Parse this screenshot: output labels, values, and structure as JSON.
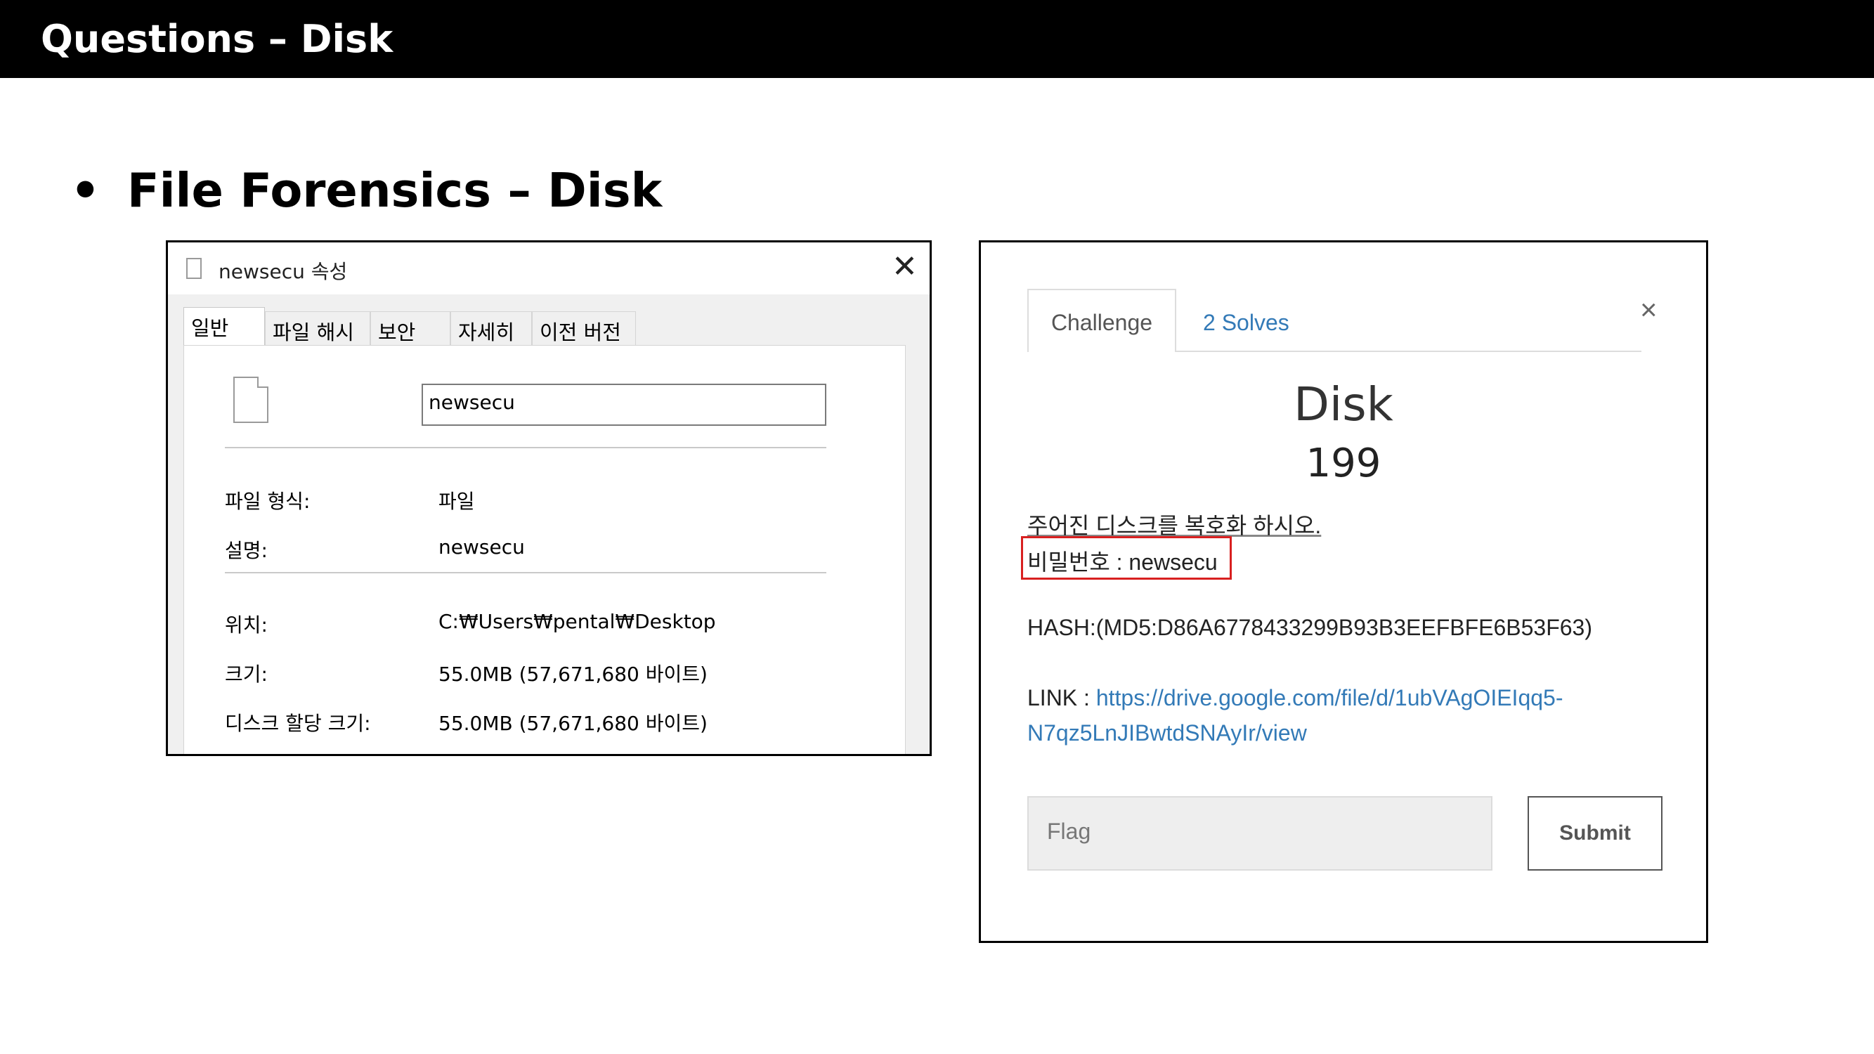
{
  "slide": {
    "header_title": "Questions – Disk",
    "bullet_symbol": "•",
    "bullet_text": "File Forensics – Disk"
  },
  "properties_window": {
    "title": "newsecu 속성",
    "close_glyph": "✕",
    "tabs": [
      "일반",
      "파일 해시",
      "보안",
      "자세히",
      "이전 버전"
    ],
    "active_tab": "일반",
    "name_value": "newsecu",
    "rows": [
      {
        "label": "파일 형식:",
        "value": "파일"
      },
      {
        "label": "설명:",
        "value": "newsecu"
      },
      {
        "label": "위치:",
        "value": "C:₩Users₩pental₩Desktop"
      },
      {
        "label": "크기:",
        "value": "55.0MB (57,671,680 바이트)"
      },
      {
        "label": "디스크 할당 크기:",
        "value": "55.0MB (57,671,680 바이트)"
      }
    ]
  },
  "challenge_modal": {
    "tabs": {
      "challenge": "Challenge",
      "solves": "2 Solves"
    },
    "close_glyph": "×",
    "name": "Disk",
    "value": "199",
    "description_line1": "주어진 디스크를 복호화 하시오.",
    "password_line": "비밀번호 : newsecu",
    "hash_line": "HASH:(MD5:D86A6778433299B93B3EEFBFE6B53F63)",
    "link_label": "LINK : ",
    "link_part1": "https://drive.google.com/file/d/1ubVAgOIEIqq5-",
    "link_part2": "N7qz5LnJIBwtdSNAyIr/view",
    "flag_placeholder": "Flag",
    "submit_label": "Submit",
    "colors": {
      "link": "#337ab7",
      "highlight_box": "#d82020"
    }
  }
}
